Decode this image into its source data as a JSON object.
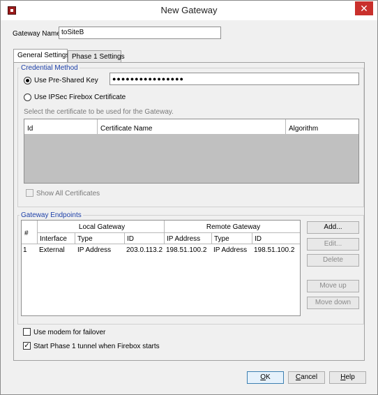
{
  "window": {
    "title": "New Gateway",
    "close_glyph": "✕"
  },
  "gateway_name": {
    "label": "Gateway Name:",
    "value": "toSiteB"
  },
  "tabs": [
    {
      "label": "General Settings",
      "active": true
    },
    {
      "label": "Phase 1 Settings",
      "active": false
    }
  ],
  "credential": {
    "group_title": "Credential Method",
    "psk_label": "Use Pre-Shared Key",
    "psk_value": "●●●●●●●●●●●●●●●●",
    "cert_label": "Use IPSec Firebox Certificate",
    "cert_hint": "Select the certificate to be used for the Gateway.",
    "table_headers": [
      "Id",
      "Certificate Name",
      "Algorithm"
    ],
    "show_all_label": "Show All Certificates"
  },
  "endpoints": {
    "group_title": "Gateway Endpoints",
    "header_num": "#",
    "local_group": "Local Gateway",
    "remote_group": "Remote Gateway",
    "columns": [
      "Interface",
      "Type",
      "ID",
      "IP Address",
      "Type",
      "ID"
    ],
    "rows": [
      {
        "num": "1",
        "interface": "External",
        "local_type": "IP Address",
        "local_id": "203.0.113.2",
        "remote_ip": "198.51.100.2",
        "remote_type": "IP Address",
        "remote_id": "198.51.100.2"
      }
    ],
    "buttons": {
      "add": "Add...",
      "edit": "Edit...",
      "delete": "Delete",
      "move_up": "Move up",
      "move_down": "Move down"
    }
  },
  "options": {
    "modem_label": "Use modem for failover",
    "modem_checked": false,
    "phase1_label": "Start Phase 1 tunnel when Firebox starts",
    "phase1_checked": true,
    "check_glyph": "✓"
  },
  "footer": {
    "ok": {
      "mnemonic": "O",
      "rest": "K"
    },
    "cancel": {
      "mnemonic": "C",
      "rest": "ancel"
    },
    "help": {
      "mnemonic": "H",
      "rest": "elp"
    }
  }
}
